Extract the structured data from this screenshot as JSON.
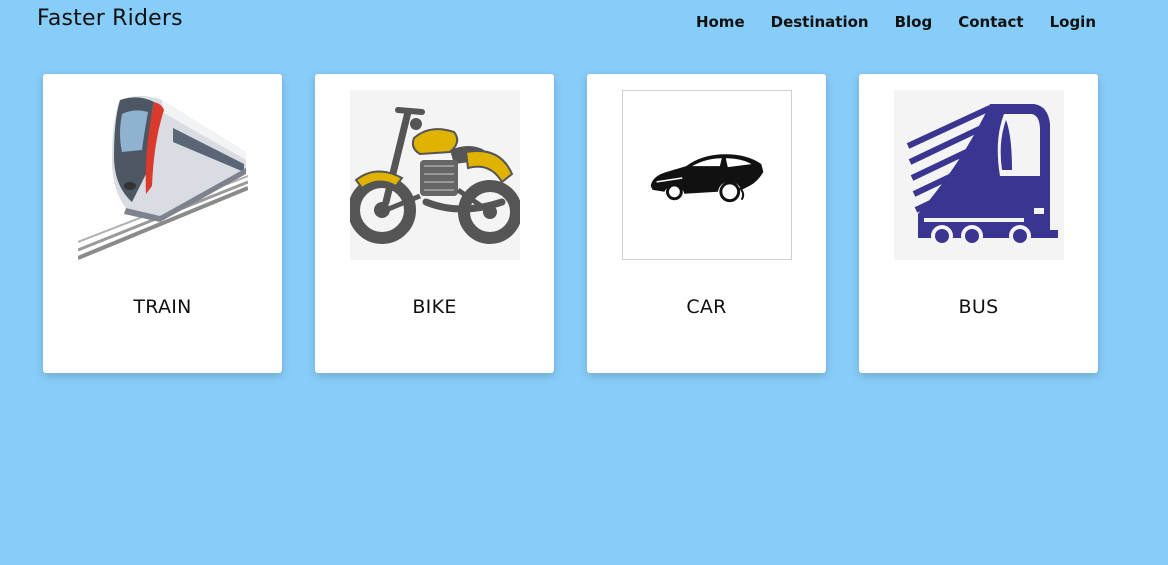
{
  "brand": "Faster Riders",
  "nav": [
    {
      "label": "Home"
    },
    {
      "label": "Destination"
    },
    {
      "label": "Blog"
    },
    {
      "label": "Contact"
    },
    {
      "label": "Login"
    }
  ],
  "cards": [
    {
      "title": "TRAIN",
      "icon": "train-icon"
    },
    {
      "title": "BIKE",
      "icon": "motorbike-icon"
    },
    {
      "title": "CAR",
      "icon": "car-icon"
    },
    {
      "title": "BUS",
      "icon": "bus-icon"
    }
  ],
  "colors": {
    "background": "#87cdf9",
    "card": "#ffffff",
    "bike_accent": "#e0b300",
    "bus_accent": "#3a3590",
    "train_accent": "#d93a2b"
  }
}
